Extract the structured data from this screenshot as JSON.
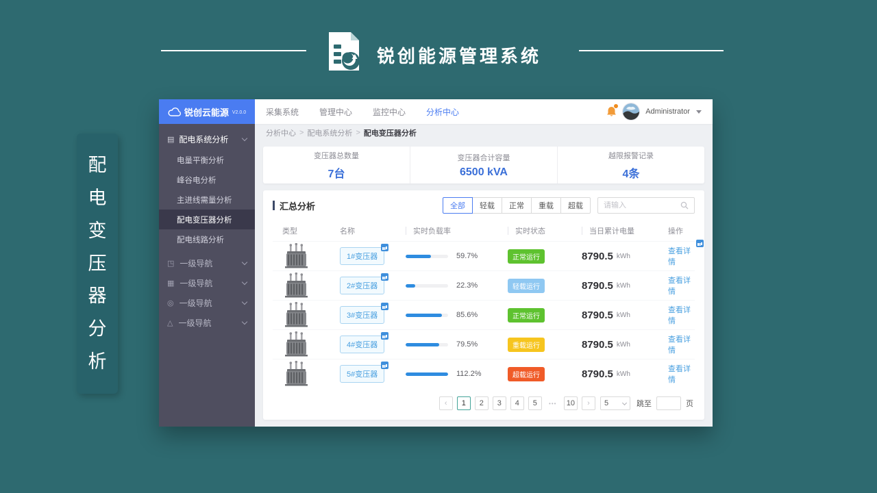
{
  "page_header": {
    "title": "锐创能源管理系统"
  },
  "side_banner": {
    "chars": [
      "配",
      "电",
      "变",
      "压",
      "器",
      "分",
      "析"
    ]
  },
  "app": {
    "sidebar": {
      "logo_text": "锐创云能源",
      "version": "V2.0.0",
      "parent_menu": {
        "label": "配电系统分析",
        "icon": "grid-icon",
        "glyph": "▤"
      },
      "submenu": [
        {
          "label": "电量平衡分析"
        },
        {
          "label": "峰谷电分析"
        },
        {
          "label": "主进线需量分析"
        },
        {
          "label": "配电变压器分析",
          "state": "active"
        },
        {
          "label": "配电线路分析"
        }
      ],
      "nav_groups": [
        {
          "label": "一级导航",
          "icon": "share-icon",
          "glyph": "◳"
        },
        {
          "label": "一级导航",
          "icon": "grid-icon",
          "glyph": "▦"
        },
        {
          "label": "一级导航",
          "icon": "check-circle-icon",
          "glyph": "◎"
        },
        {
          "label": "一级导航",
          "icon": "alert-triangle-icon",
          "glyph": "△"
        }
      ]
    },
    "topnav": {
      "items": [
        {
          "label": "采集系统"
        },
        {
          "label": "管理中心"
        },
        {
          "label": "监控中心"
        },
        {
          "label": "分析中心",
          "state": "active"
        }
      ],
      "username": "Administrator"
    },
    "breadcrumb": [
      {
        "label": "分析中心",
        "sep": ">"
      },
      {
        "label": "配电系统分析",
        "sep": ">"
      },
      {
        "label": "配电变压器分析",
        "state": "current"
      }
    ],
    "stats": [
      {
        "label": "变压器总数量",
        "value": "7台"
      },
      {
        "label": "变压器合计容量",
        "value": "6500 kVA"
      },
      {
        "label": "越限报警记录",
        "value": "4条"
      }
    ],
    "panel": {
      "section_title": "汇总分析",
      "filters": [
        {
          "label": "全部",
          "state": "active"
        },
        {
          "label": "轻载"
        },
        {
          "label": "正常"
        },
        {
          "label": "重载"
        },
        {
          "label": "超载"
        }
      ],
      "search_placeholder": "请输入",
      "table": {
        "headers": [
          {
            "label": "类型",
            "col": "c1"
          },
          {
            "label": "名称",
            "col": "c2"
          },
          {
            "label": "实时负载率",
            "col": "c3",
            "sep": "sep"
          },
          {
            "label": "实时状态",
            "col": "c4",
            "sep": "sep"
          },
          {
            "label": "当日累计电量",
            "col": "c5",
            "sep": "sep"
          },
          {
            "label": "操作",
            "col": "c6"
          }
        ],
        "unit": "kWh",
        "action_label": "查看详情",
        "rows": [
          {
            "name": "1#变压器",
            "load": "59.7%",
            "load_pct": 59.7,
            "status": "正常运行",
            "status_type": "normal",
            "energy": "8790.5",
            "abadge": "on"
          },
          {
            "name": "2#变压器",
            "load": "22.3%",
            "load_pct": 22.3,
            "status": "轻载运行",
            "status_type": "light",
            "energy": "8790.5"
          },
          {
            "name": "3#变压器",
            "load": "85.6%",
            "load_pct": 85.6,
            "status": "正常运行",
            "status_type": "normal",
            "energy": "8790.5"
          },
          {
            "name": "4#变压器",
            "load": "79.5%",
            "load_pct": 79.5,
            "status": "重载运行",
            "status_type": "heavy",
            "energy": "8790.5"
          },
          {
            "name": "5#变压器",
            "load": "112.2%",
            "load_pct": 112.2,
            "status": "超载运行",
            "status_type": "over",
            "energy": "8790.5"
          }
        ]
      },
      "pagination": {
        "items": [
          {
            "label": "‹",
            "kind": "arrow"
          },
          {
            "label": "1",
            "kind": "page",
            "state": "active"
          },
          {
            "label": "2",
            "kind": "page"
          },
          {
            "label": "3",
            "kind": "page"
          },
          {
            "label": "4",
            "kind": "page"
          },
          {
            "label": "5",
            "kind": "page"
          },
          {
            "label": "•••",
            "kind": "dots"
          },
          {
            "label": "10",
            "kind": "page"
          },
          {
            "label": "›",
            "kind": "arrow"
          }
        ],
        "page_size": "5",
        "jump_label": "跳至",
        "page_unit": "页"
      }
    }
  },
  "colors": {
    "background_teal": "#2e6a70",
    "banner_teal": "#28626a",
    "sidebar_bg": "#4f4e5f",
    "sidebar_active_bg": "#3a394b",
    "logo_blue": "#4a7cf1",
    "accent_blue": "#4a7cf1",
    "stat_value_blue": "#3a6fd8",
    "progress_blue": "#2e8ce0",
    "status_normal_green": "#5ec22f",
    "status_light_blue": "#8fc8f2",
    "status_heavy_yellow": "#f6c51f",
    "status_over_red": "#f05b28",
    "bell_orange": "#f29b38"
  }
}
